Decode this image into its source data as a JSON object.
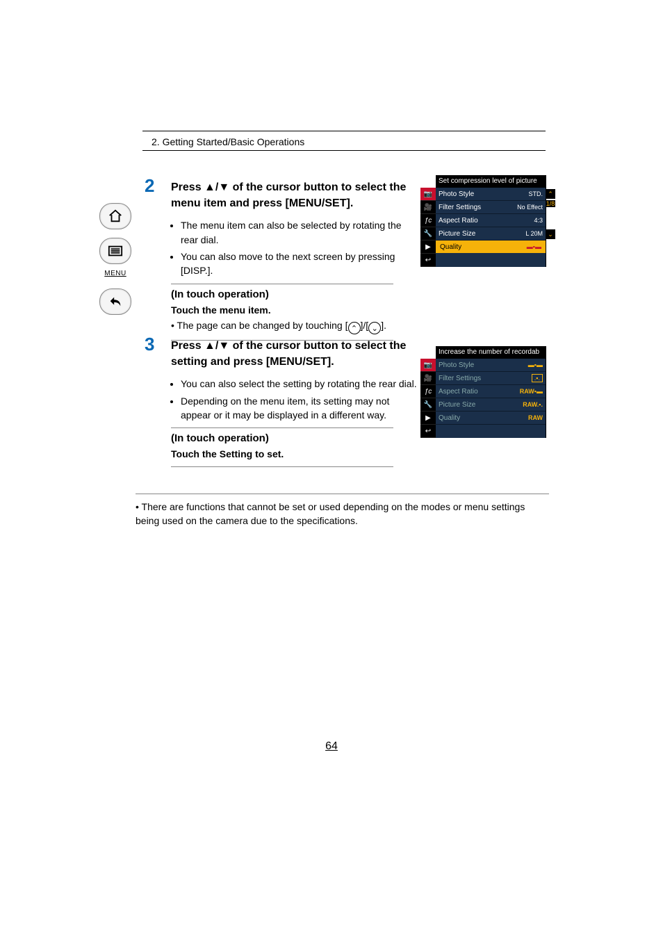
{
  "header": {
    "section": "2. Getting Started/Basic Operations"
  },
  "sidebar": {
    "menu_label": "MENU"
  },
  "step2": {
    "num": "2",
    "title_a": "Press ",
    "title_b": " of the cursor button to select the menu item and press [MENU/SET].",
    "arrows": "▲/▼",
    "bullets": [
      "The menu item can also be selected by rotating the rear dial.",
      "You can also move to the next screen by pressing [DISP.]."
    ],
    "touch_head": "(In touch operation)",
    "touch_bold": "Touch the menu item.",
    "touch_text_a": "• The page can be changed by touching [",
    "touch_text_b": "]/[",
    "touch_text_c": "]."
  },
  "step3": {
    "num": "3",
    "title_a": "Press ",
    "title_b": " of the cursor button to select the setting and press [MENU/SET].",
    "arrows": "▲/▼",
    "bullets": [
      "You can also select the setting by rotating the rear dial.",
      "Depending on the menu item, its setting may not appear or it may be displayed in a different way."
    ],
    "touch_head": "(In touch operation)",
    "touch_bold": "Touch the Setting to set."
  },
  "note": "• There are functions that cannot be set or used depending on the modes or menu settings being used on the camera due to the specifications.",
  "page_number": "64",
  "menu1": {
    "header": "Set compression level of picture",
    "rows": [
      {
        "label": "Photo Style",
        "val": "STD."
      },
      {
        "label": "Filter Settings",
        "val": "No Effect"
      },
      {
        "label": "Aspect Ratio",
        "val": "4:3"
      },
      {
        "label": "Picture Size",
        "val": "L 20M"
      },
      {
        "label": "Quality",
        "val": "",
        "sel": true
      }
    ],
    "page": "1/8"
  },
  "menu2": {
    "header": "Increase the number of recordab",
    "rows": [
      {
        "label": "Photo Style",
        "val": ""
      },
      {
        "label": "Filter Settings",
        "val": ""
      },
      {
        "label": "Aspect Ratio",
        "val": "RAW"
      },
      {
        "label": "Picture Size",
        "val": "RAW"
      },
      {
        "label": "Quality",
        "val": "RAW"
      }
    ]
  }
}
